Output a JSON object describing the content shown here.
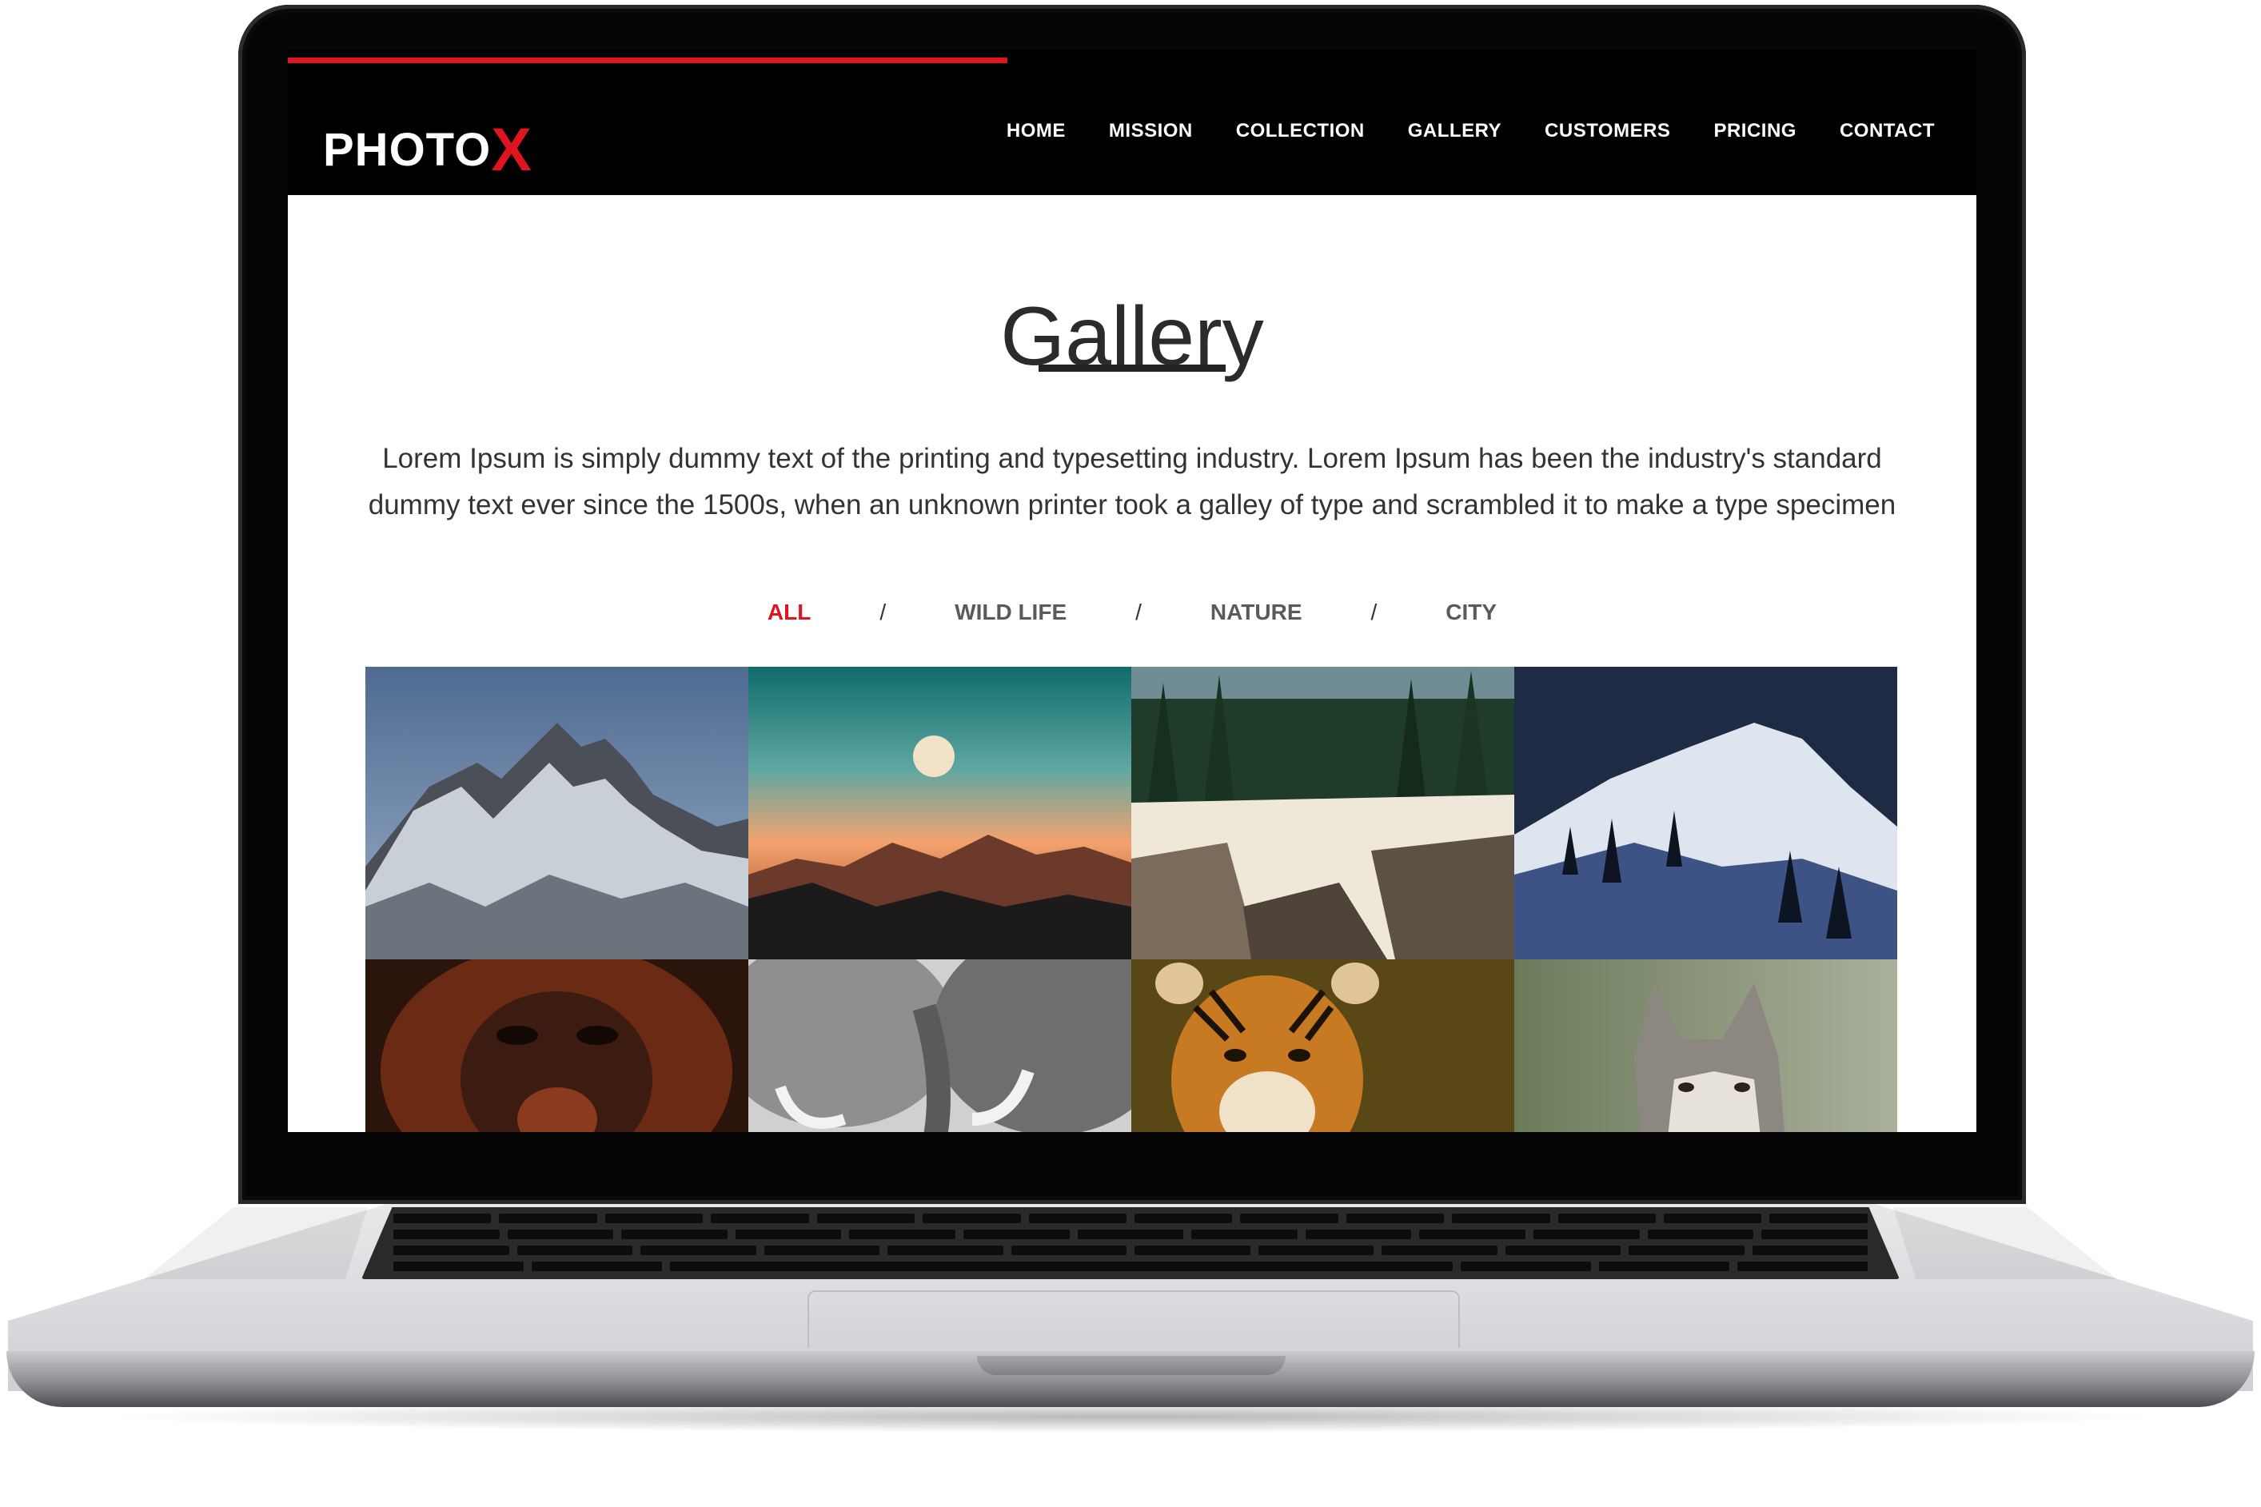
{
  "site": {
    "logo_text": "PHOTO",
    "logo_accent": "X",
    "accent_color": "#e0141e",
    "header_bg": "#000000"
  },
  "nav": {
    "items": [
      "HOME",
      "MISSION",
      "COLLECTION",
      "GALLERY",
      "CUSTOMERS",
      "PRICING",
      "CONTACT"
    ]
  },
  "gallery": {
    "title": "Gallery",
    "intro": "Lorem Ipsum is simply dummy text of the printing and typesetting industry. Lorem Ipsum has been the industry's standard dummy text ever since the 1500s, when an unknown printer took a galley of type and scrambled it to make a type specimen",
    "filters": [
      "ALL",
      "WILD LIFE",
      "NATURE",
      "CITY"
    ],
    "active_filter": "ALL",
    "separator": "/",
    "photos": [
      {
        "subject": "snowy-mountain-peaks"
      },
      {
        "subject": "moon-over-mountain-sunset"
      },
      {
        "subject": "forest-waterfall-river"
      },
      {
        "subject": "snowy-hill-pine-trees"
      },
      {
        "subject": "orangutan"
      },
      {
        "subject": "elephants"
      },
      {
        "subject": "tiger"
      },
      {
        "subject": "wolf"
      }
    ]
  }
}
